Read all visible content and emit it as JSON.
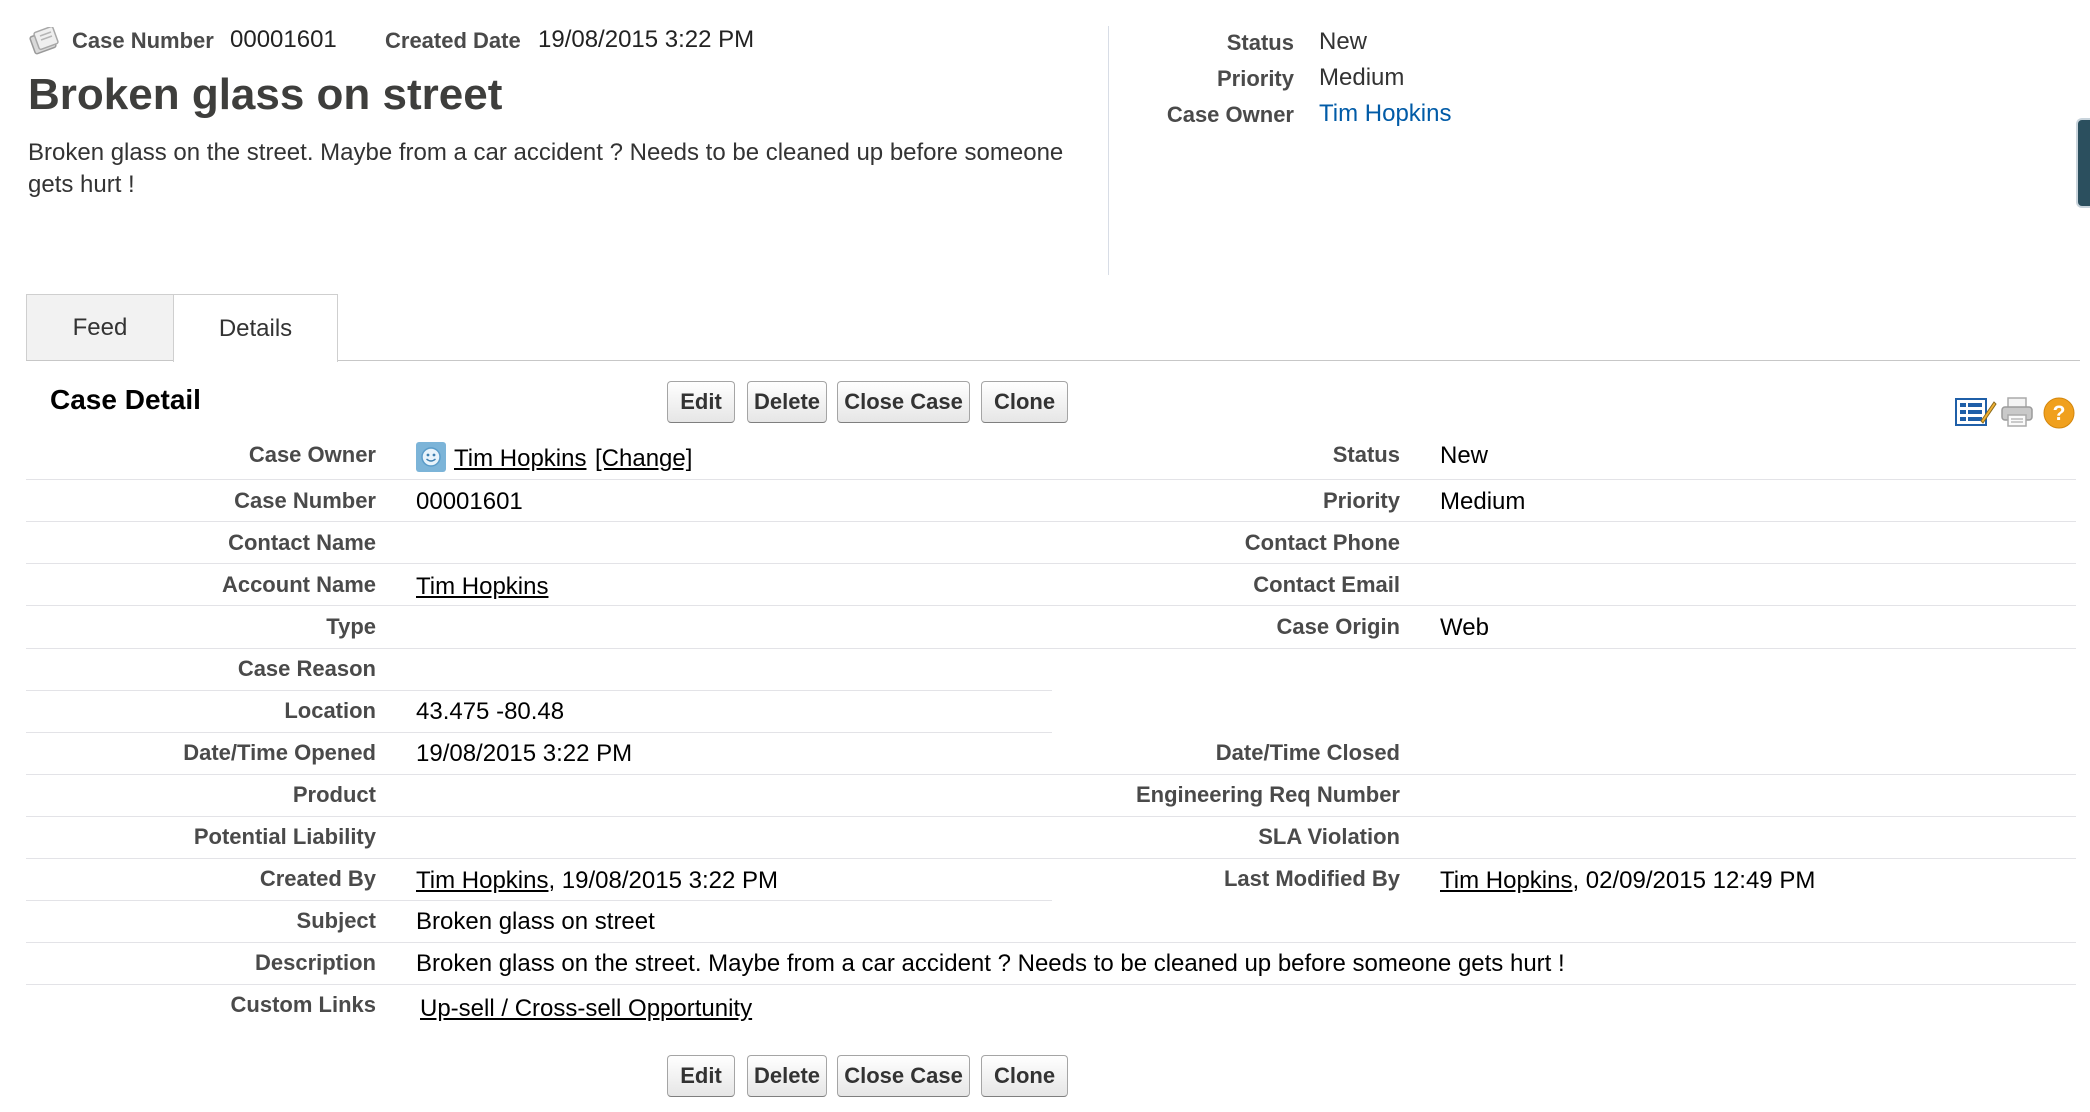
{
  "header": {
    "case_number_label": "Case Number",
    "case_number": "00001601",
    "created_date_label": "Created Date",
    "created_date": "19/08/2015 3:22 PM",
    "title": "Broken glass on street",
    "description": "Broken glass on the street. Maybe from a car accident ? Needs to be cleaned up before someone gets hurt !",
    "status_label": "Status",
    "status": "New",
    "priority_label": "Priority",
    "priority": "Medium",
    "owner_label": "Case Owner",
    "owner": "Tim Hopkins"
  },
  "tabs": [
    {
      "label": "Feed"
    },
    {
      "label": "Details"
    }
  ],
  "section": {
    "title": "Case Detail",
    "buttons": {
      "edit": "Edit",
      "delete": "Delete",
      "close_case": "Close Case",
      "clone": "Clone"
    }
  },
  "details": {
    "case_owner": {
      "label": "Case Owner",
      "value": "Tim Hopkins",
      "change": "[Change]"
    },
    "status": {
      "label": "Status",
      "value": "New"
    },
    "case_number": {
      "label": "Case Number",
      "value": "00001601"
    },
    "priority": {
      "label": "Priority",
      "value": "Medium"
    },
    "contact_name": {
      "label": "Contact Name",
      "value": ""
    },
    "contact_phone": {
      "label": "Contact Phone",
      "value": ""
    },
    "account_name": {
      "label": "Account Name",
      "value": "Tim Hopkins"
    },
    "contact_email": {
      "label": "Contact Email",
      "value": ""
    },
    "type": {
      "label": "Type",
      "value": ""
    },
    "case_origin": {
      "label": "Case Origin",
      "value": "Web"
    },
    "case_reason": {
      "label": "Case Reason",
      "value": ""
    },
    "location": {
      "label": "Location",
      "value": "43.475 -80.48"
    },
    "date_opened": {
      "label": "Date/Time Opened",
      "value": "19/08/2015 3:22 PM"
    },
    "date_closed": {
      "label": "Date/Time Closed",
      "value": ""
    },
    "product": {
      "label": "Product",
      "value": ""
    },
    "engineering_req": {
      "label": "Engineering Req Number",
      "value": ""
    },
    "potential_liability": {
      "label": "Potential Liability",
      "value": ""
    },
    "sla_violation": {
      "label": "SLA Violation",
      "value": ""
    },
    "created_by": {
      "label": "Created By",
      "user": "Tim Hopkins",
      "date": ", 19/08/2015 3:22 PM"
    },
    "last_modified_by": {
      "label": "Last Modified By",
      "user": "Tim Hopkins",
      "date": ", 02/09/2015 12:49 PM"
    },
    "subject": {
      "label": "Subject",
      "value": "Broken glass on street"
    },
    "description": {
      "label": "Description",
      "value": "Broken glass on the street. Maybe from a car accident ? Needs to be cleaned up before someone gets hurt !"
    },
    "custom_links": {
      "label": "Custom Links",
      "value": "Up-sell / Cross-sell Opportunity"
    }
  },
  "icons": [
    "case-icon",
    "customize-page-icon",
    "printer-icon",
    "help-icon",
    "user-avatar-icon"
  ],
  "colors": {
    "link": "#015ba7",
    "help": "#f0a01e",
    "tab_bg": "#f2f2f2"
  }
}
